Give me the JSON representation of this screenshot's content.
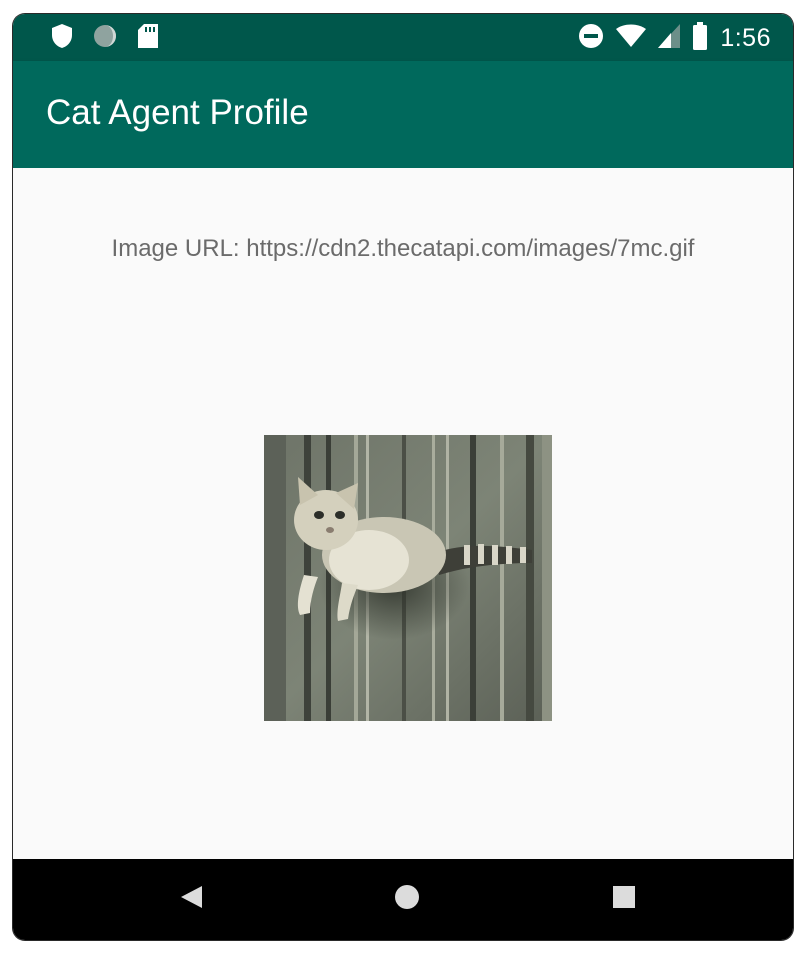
{
  "status_bar": {
    "time": "1:56",
    "left_icons": [
      "shield-icon",
      "sync-icon",
      "sd-card-icon"
    ],
    "right_icons": [
      "do-not-disturb-icon",
      "wifi-icon",
      "cell-signal-icon",
      "battery-icon"
    ]
  },
  "app_bar": {
    "title": "Cat Agent Profile",
    "color": "#00695c"
  },
  "content": {
    "image_url_text": "Image URL: https://cdn2.thecatapi.com/images/7mc.gif",
    "image_icon": "cat-photo"
  },
  "nav_bar": {
    "buttons": [
      "back-icon",
      "home-icon",
      "recents-icon"
    ]
  },
  "colors": {
    "status_bar": "#00574b",
    "primary": "#00695c",
    "background": "#fafafa",
    "text_secondary": "#6b6b6b"
  }
}
